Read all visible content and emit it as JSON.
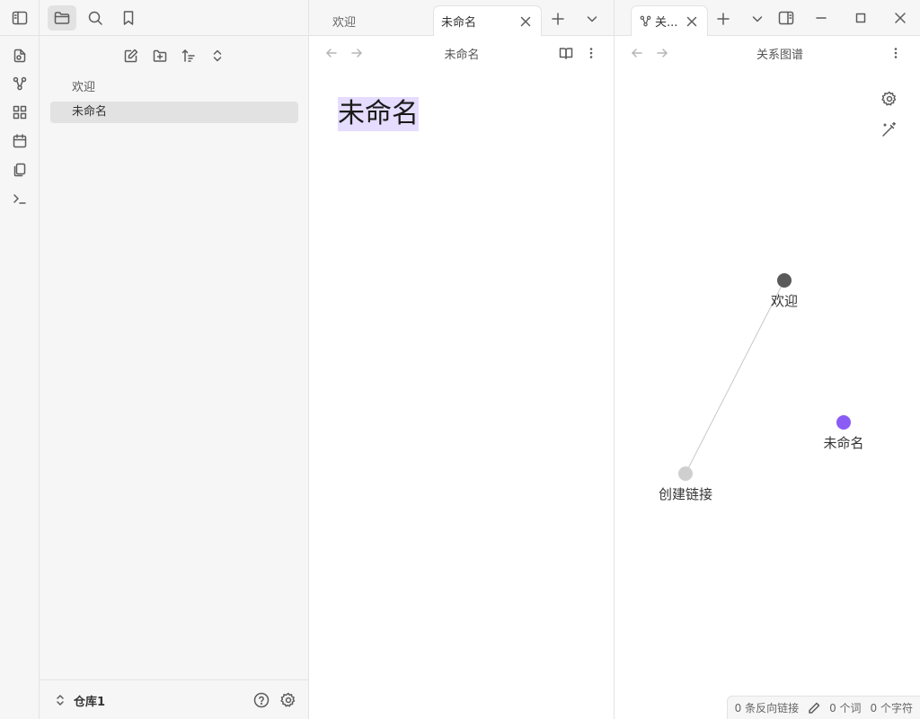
{
  "sidebar": {
    "tree": [
      {
        "label": "欢迎",
        "active": false
      },
      {
        "label": "未命名",
        "active": true
      }
    ],
    "vault_name": "仓库1"
  },
  "left_pane": {
    "tabs": [
      {
        "label": "欢迎",
        "active": false
      },
      {
        "label": "未命名",
        "active": true
      }
    ],
    "view_title": "未命名",
    "note_title": "未命名"
  },
  "right_pane": {
    "tab_label": "关...",
    "view_title": "关系图谱",
    "graph": {
      "nodes": [
        {
          "label": "欢迎",
          "color": "#5a5a5a"
        },
        {
          "label": "未命名",
          "color": "#8a5cf5"
        },
        {
          "label": "创建链接",
          "color": "#cfcfcf"
        }
      ]
    }
  },
  "status_bar": {
    "backlinks": "0 条反向链接",
    "words": "0 个词",
    "chars": "0 个字符"
  },
  "colors": {
    "accent": "#8a5cf5",
    "highlight": "#e6dcff"
  }
}
